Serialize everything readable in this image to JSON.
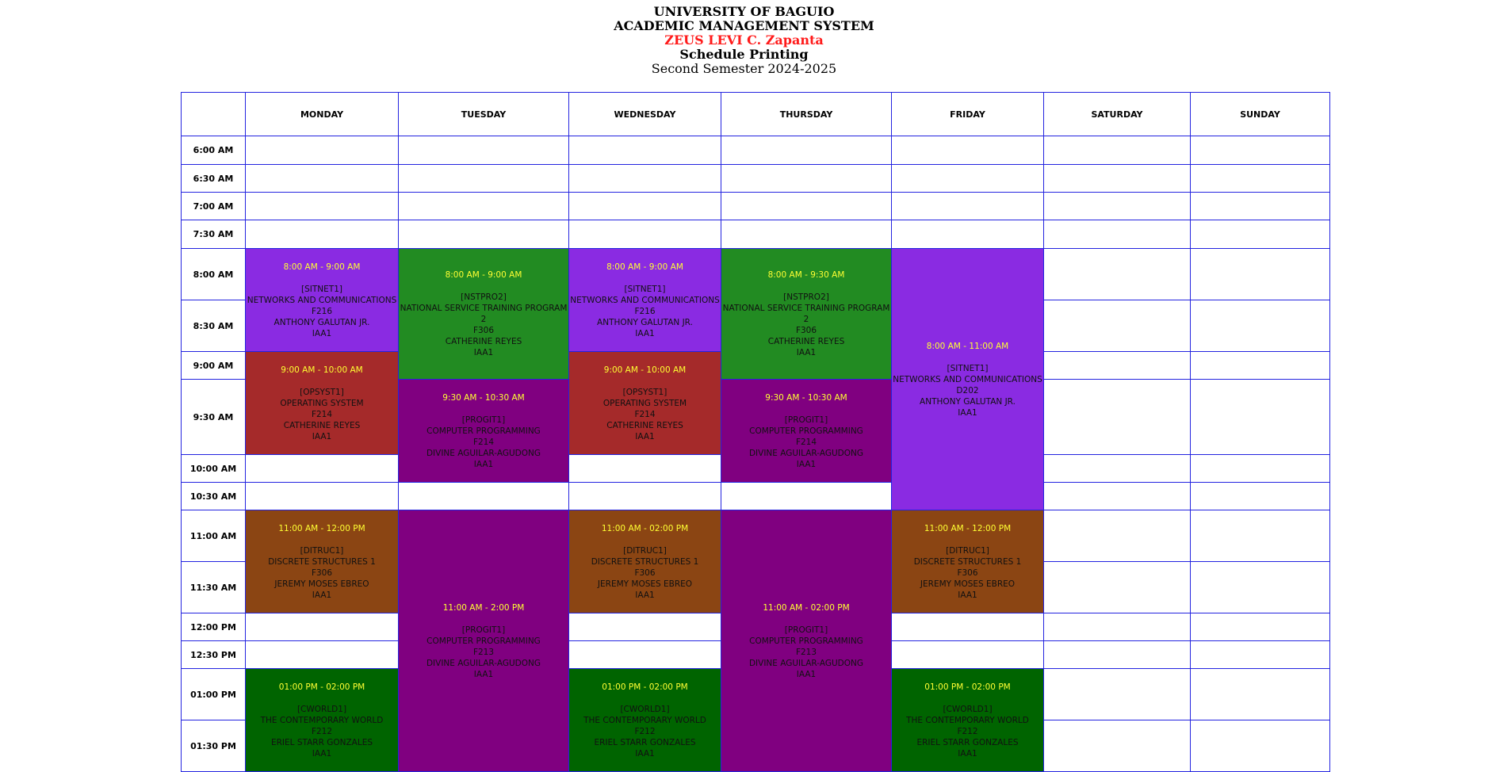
{
  "header": {
    "university": "UNIVERSITY OF BAGUIO",
    "system": "ACADEMIC MANAGEMENT SYSTEM",
    "student": "ZEUS LEVI C. Zapanta",
    "title": "Schedule Printing",
    "semester": "Second Semester 2024-2025"
  },
  "days": [
    "MONDAY",
    "TUESDAY",
    "WEDNESDAY",
    "THURSDAY",
    "FRIDAY",
    "SATURDAY",
    "SUNDAY"
  ],
  "times": [
    "6:00 AM",
    "6:30 AM",
    "7:00 AM",
    "7:30 AM",
    "8:00 AM",
    "8:30 AM",
    "9:00 AM",
    "9:30 AM",
    "10:00 AM",
    "10:30 AM",
    "11:00 AM",
    "11:30 AM",
    "12:00 PM",
    "12:30 PM",
    "01:00 PM",
    "01:30 PM"
  ],
  "colors": {
    "border": "#2323e0",
    "violet": "#8a2be2",
    "forest": "#228b22",
    "brown_red": "#a52a2a",
    "purple": "#800080",
    "saddle": "#8b4513",
    "dark_green": "#006400",
    "time_text": "#ffff33",
    "student_name": "#ff1a1a"
  },
  "classes": [
    {
      "day": 0,
      "start": 4,
      "span": 2,
      "color": "violet",
      "time": "8:00 AM - 9:00 AM",
      "code": "[SITNET1]",
      "title": "NETWORKS AND COMMUNICATIONS",
      "room": "F216",
      "instructor": "ANTHONY GALUTAN JR.",
      "section": "IAA1"
    },
    {
      "day": 1,
      "start": 4,
      "span": 3,
      "color": "forest",
      "time": "8:00 AM - 9:00 AM",
      "code": "[NSTPRO2]",
      "title": "NATIONAL SERVICE TRAINING PROGRAM 2",
      "room": "F306",
      "instructor": "CATHERINE REYES",
      "section": "IAA1"
    },
    {
      "day": 2,
      "start": 4,
      "span": 2,
      "color": "violet",
      "time": "8:00 AM - 9:00 AM",
      "code": "[SITNET1]",
      "title": "NETWORKS AND COMMUNICATIONS",
      "room": "F216",
      "instructor": "ANTHONY GALUTAN JR.",
      "section": "IAA1"
    },
    {
      "day": 3,
      "start": 4,
      "span": 3,
      "color": "forest",
      "time": "8:00 AM - 9:30 AM",
      "code": "[NSTPRO2]",
      "title": "NATIONAL SERVICE TRAINING PROGRAM 2",
      "room": "F306",
      "instructor": "CATHERINE REYES",
      "section": "IAA1"
    },
    {
      "day": 4,
      "start": 4,
      "span": 6,
      "color": "violet",
      "time": "8:00 AM - 11:00 AM",
      "code": "[SITNET1]",
      "title": "NETWORKS AND COMMUNICATIONS",
      "room": "D202",
      "instructor": "ANTHONY GALUTAN JR.",
      "section": "IAA1"
    },
    {
      "day": 0,
      "start": 6,
      "span": 2,
      "color": "brown_red",
      "time": "9:00 AM - 10:00 AM",
      "code": "[OPSYST1]",
      "title": "OPERATING SYSTEM",
      "room": "F214",
      "instructor": "CATHERINE REYES",
      "section": "IAA1"
    },
    {
      "day": 2,
      "start": 6,
      "span": 2,
      "color": "brown_red",
      "time": "9:00 AM - 10:00 AM",
      "code": "[OPSYST1]",
      "title": "OPERATING SYSTEM",
      "room": "F214",
      "instructor": "CATHERINE REYES",
      "section": "IAA1"
    },
    {
      "day": 1,
      "start": 7,
      "span": 2,
      "color": "purple",
      "time": "9:30 AM - 10:30 AM",
      "code": "[PROGIT1]",
      "title": "COMPUTER PROGRAMMING",
      "room": "F214",
      "instructor": "DIVINE AGUILAR-AGUDONG",
      "section": "IAA1"
    },
    {
      "day": 3,
      "start": 7,
      "span": 2,
      "color": "purple",
      "time": "9:30 AM - 10:30 AM",
      "code": "[PROGIT1]",
      "title": "COMPUTER PROGRAMMING",
      "room": "F214",
      "instructor": "DIVINE AGUILAR-AGUDONG",
      "section": "IAA1"
    },
    {
      "day": 0,
      "start": 10,
      "span": 2,
      "color": "saddle",
      "time": "11:00 AM - 12:00 PM",
      "code": "[DITRUC1]",
      "title": "DISCRETE STRUCTURES 1",
      "room": "F306",
      "instructor": "JEREMY MOSES EBREO",
      "section": "IAA1"
    },
    {
      "day": 1,
      "start": 10,
      "span": 6,
      "color": "purple",
      "time": "11:00 AM - 2:00 PM",
      "code": "[PROGIT1]",
      "title": "COMPUTER PROGRAMMING",
      "room": "F213",
      "instructor": "DIVINE AGUILAR-AGUDONG",
      "section": "IAA1"
    },
    {
      "day": 2,
      "start": 10,
      "span": 2,
      "color": "saddle",
      "time": "11:00 AM - 02:00 PM",
      "code": "[DITRUC1]",
      "title": "DISCRETE STRUCTURES 1",
      "room": "F306",
      "instructor": "JEREMY MOSES EBREO",
      "section": "IAA1"
    },
    {
      "day": 3,
      "start": 10,
      "span": 6,
      "color": "purple",
      "time": "11:00 AM - 02:00 PM",
      "code": "[PROGIT1]",
      "title": "COMPUTER PROGRAMMING",
      "room": "F213",
      "instructor": "DIVINE AGUILAR-AGUDONG",
      "section": "IAA1"
    },
    {
      "day": 4,
      "start": 10,
      "span": 2,
      "color": "saddle",
      "time": "11:00 AM - 12:00 PM",
      "code": "[DITRUC1]",
      "title": "DISCRETE STRUCTURES 1",
      "room": "F306",
      "instructor": "JEREMY MOSES EBREO",
      "section": "IAA1"
    },
    {
      "day": 0,
      "start": 14,
      "span": 2,
      "color": "dark_green",
      "time": "01:00 PM - 02:00 PM",
      "code": "[CWORLD1]",
      "title": "THE CONTEMPORARY WORLD",
      "room": "F212",
      "instructor": "ERIEL STARR GONZALES",
      "section": "IAA1"
    },
    {
      "day": 2,
      "start": 14,
      "span": 2,
      "color": "dark_green",
      "time": "01:00 PM - 02:00 PM",
      "code": "[CWORLD1]",
      "title": "THE CONTEMPORARY WORLD",
      "room": "F212",
      "instructor": "ERIEL STARR GONZALES",
      "section": "IAA1"
    },
    {
      "day": 4,
      "start": 14,
      "span": 2,
      "color": "dark_green",
      "time": "01:00 PM - 02:00 PM",
      "code": "[CWORLD1]",
      "title": "THE CONTEMPORARY WORLD",
      "room": "F212",
      "instructor": "ERIEL STARR GONZALES",
      "section": "IAA1"
    }
  ]
}
